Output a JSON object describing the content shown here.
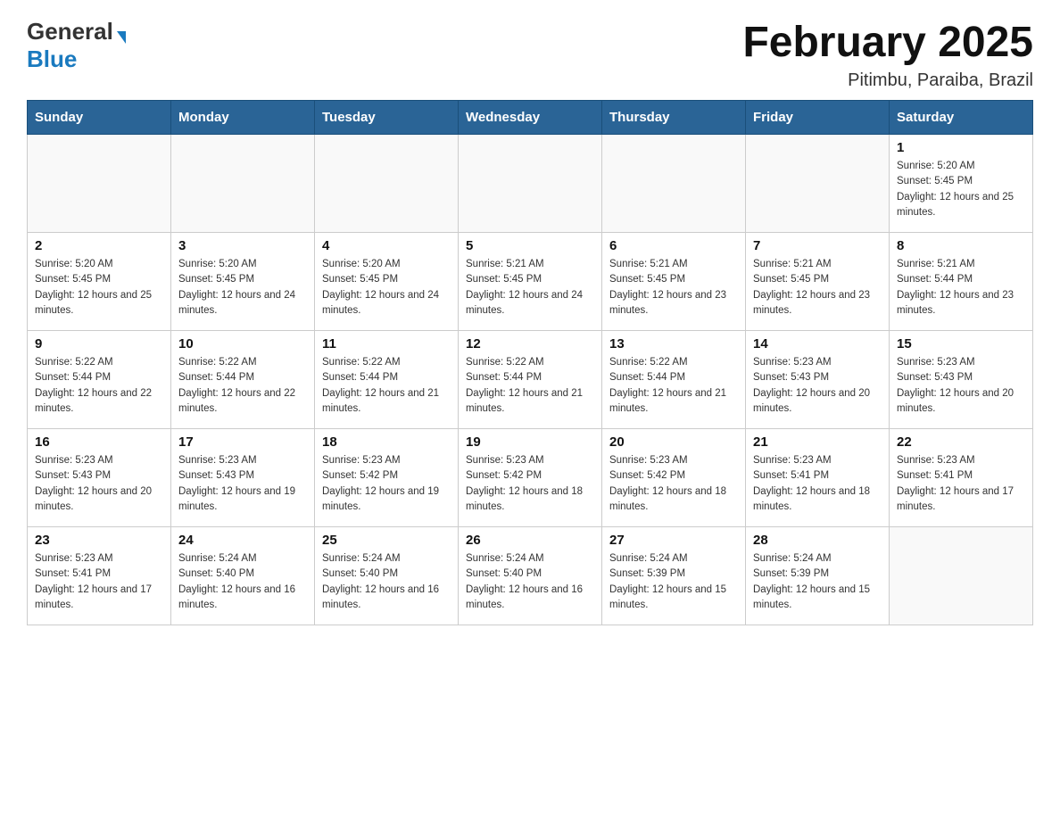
{
  "header": {
    "logo_general": "General",
    "logo_blue": "Blue",
    "month": "February 2025",
    "location": "Pitimbu, Paraiba, Brazil"
  },
  "weekdays": [
    "Sunday",
    "Monday",
    "Tuesday",
    "Wednesday",
    "Thursday",
    "Friday",
    "Saturday"
  ],
  "weeks": [
    [
      {
        "day": "",
        "sunrise": "",
        "sunset": "",
        "daylight": ""
      },
      {
        "day": "",
        "sunrise": "",
        "sunset": "",
        "daylight": ""
      },
      {
        "day": "",
        "sunrise": "",
        "sunset": "",
        "daylight": ""
      },
      {
        "day": "",
        "sunrise": "",
        "sunset": "",
        "daylight": ""
      },
      {
        "day": "",
        "sunrise": "",
        "sunset": "",
        "daylight": ""
      },
      {
        "day": "",
        "sunrise": "",
        "sunset": "",
        "daylight": ""
      },
      {
        "day": "1",
        "sunrise": "Sunrise: 5:20 AM",
        "sunset": "Sunset: 5:45 PM",
        "daylight": "Daylight: 12 hours and 25 minutes."
      }
    ],
    [
      {
        "day": "2",
        "sunrise": "Sunrise: 5:20 AM",
        "sunset": "Sunset: 5:45 PM",
        "daylight": "Daylight: 12 hours and 25 minutes."
      },
      {
        "day": "3",
        "sunrise": "Sunrise: 5:20 AM",
        "sunset": "Sunset: 5:45 PM",
        "daylight": "Daylight: 12 hours and 24 minutes."
      },
      {
        "day": "4",
        "sunrise": "Sunrise: 5:20 AM",
        "sunset": "Sunset: 5:45 PM",
        "daylight": "Daylight: 12 hours and 24 minutes."
      },
      {
        "day": "5",
        "sunrise": "Sunrise: 5:21 AM",
        "sunset": "Sunset: 5:45 PM",
        "daylight": "Daylight: 12 hours and 24 minutes."
      },
      {
        "day": "6",
        "sunrise": "Sunrise: 5:21 AM",
        "sunset": "Sunset: 5:45 PM",
        "daylight": "Daylight: 12 hours and 23 minutes."
      },
      {
        "day": "7",
        "sunrise": "Sunrise: 5:21 AM",
        "sunset": "Sunset: 5:45 PM",
        "daylight": "Daylight: 12 hours and 23 minutes."
      },
      {
        "day": "8",
        "sunrise": "Sunrise: 5:21 AM",
        "sunset": "Sunset: 5:44 PM",
        "daylight": "Daylight: 12 hours and 23 minutes."
      }
    ],
    [
      {
        "day": "9",
        "sunrise": "Sunrise: 5:22 AM",
        "sunset": "Sunset: 5:44 PM",
        "daylight": "Daylight: 12 hours and 22 minutes."
      },
      {
        "day": "10",
        "sunrise": "Sunrise: 5:22 AM",
        "sunset": "Sunset: 5:44 PM",
        "daylight": "Daylight: 12 hours and 22 minutes."
      },
      {
        "day": "11",
        "sunrise": "Sunrise: 5:22 AM",
        "sunset": "Sunset: 5:44 PM",
        "daylight": "Daylight: 12 hours and 21 minutes."
      },
      {
        "day": "12",
        "sunrise": "Sunrise: 5:22 AM",
        "sunset": "Sunset: 5:44 PM",
        "daylight": "Daylight: 12 hours and 21 minutes."
      },
      {
        "day": "13",
        "sunrise": "Sunrise: 5:22 AM",
        "sunset": "Sunset: 5:44 PM",
        "daylight": "Daylight: 12 hours and 21 minutes."
      },
      {
        "day": "14",
        "sunrise": "Sunrise: 5:23 AM",
        "sunset": "Sunset: 5:43 PM",
        "daylight": "Daylight: 12 hours and 20 minutes."
      },
      {
        "day": "15",
        "sunrise": "Sunrise: 5:23 AM",
        "sunset": "Sunset: 5:43 PM",
        "daylight": "Daylight: 12 hours and 20 minutes."
      }
    ],
    [
      {
        "day": "16",
        "sunrise": "Sunrise: 5:23 AM",
        "sunset": "Sunset: 5:43 PM",
        "daylight": "Daylight: 12 hours and 20 minutes."
      },
      {
        "day": "17",
        "sunrise": "Sunrise: 5:23 AM",
        "sunset": "Sunset: 5:43 PM",
        "daylight": "Daylight: 12 hours and 19 minutes."
      },
      {
        "day": "18",
        "sunrise": "Sunrise: 5:23 AM",
        "sunset": "Sunset: 5:42 PM",
        "daylight": "Daylight: 12 hours and 19 minutes."
      },
      {
        "day": "19",
        "sunrise": "Sunrise: 5:23 AM",
        "sunset": "Sunset: 5:42 PM",
        "daylight": "Daylight: 12 hours and 18 minutes."
      },
      {
        "day": "20",
        "sunrise": "Sunrise: 5:23 AM",
        "sunset": "Sunset: 5:42 PM",
        "daylight": "Daylight: 12 hours and 18 minutes."
      },
      {
        "day": "21",
        "sunrise": "Sunrise: 5:23 AM",
        "sunset": "Sunset: 5:41 PM",
        "daylight": "Daylight: 12 hours and 18 minutes."
      },
      {
        "day": "22",
        "sunrise": "Sunrise: 5:23 AM",
        "sunset": "Sunset: 5:41 PM",
        "daylight": "Daylight: 12 hours and 17 minutes."
      }
    ],
    [
      {
        "day": "23",
        "sunrise": "Sunrise: 5:23 AM",
        "sunset": "Sunset: 5:41 PM",
        "daylight": "Daylight: 12 hours and 17 minutes."
      },
      {
        "day": "24",
        "sunrise": "Sunrise: 5:24 AM",
        "sunset": "Sunset: 5:40 PM",
        "daylight": "Daylight: 12 hours and 16 minutes."
      },
      {
        "day": "25",
        "sunrise": "Sunrise: 5:24 AM",
        "sunset": "Sunset: 5:40 PM",
        "daylight": "Daylight: 12 hours and 16 minutes."
      },
      {
        "day": "26",
        "sunrise": "Sunrise: 5:24 AM",
        "sunset": "Sunset: 5:40 PM",
        "daylight": "Daylight: 12 hours and 16 minutes."
      },
      {
        "day": "27",
        "sunrise": "Sunrise: 5:24 AM",
        "sunset": "Sunset: 5:39 PM",
        "daylight": "Daylight: 12 hours and 15 minutes."
      },
      {
        "day": "28",
        "sunrise": "Sunrise: 5:24 AM",
        "sunset": "Sunset: 5:39 PM",
        "daylight": "Daylight: 12 hours and 15 minutes."
      },
      {
        "day": "",
        "sunrise": "",
        "sunset": "",
        "daylight": ""
      }
    ]
  ]
}
